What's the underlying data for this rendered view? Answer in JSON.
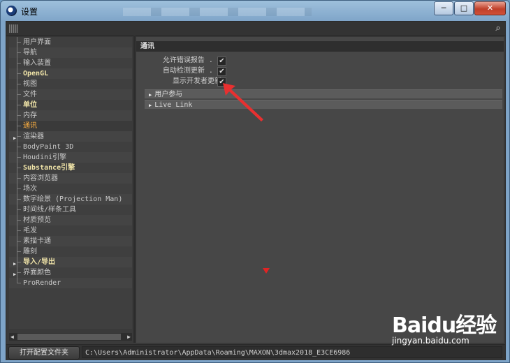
{
  "window": {
    "title": "设置",
    "controls": [
      "─",
      "□",
      "✕"
    ]
  },
  "tree": {
    "items": [
      {
        "label": "用户界面",
        "style": "",
        "expander": false
      },
      {
        "label": "导航",
        "style": "",
        "expander": false
      },
      {
        "label": "输入装置",
        "style": "",
        "expander": false
      },
      {
        "label": "OpenGL",
        "style": "bold",
        "expander": false
      },
      {
        "label": "视图",
        "style": "",
        "expander": false
      },
      {
        "label": "文件",
        "style": "",
        "expander": false
      },
      {
        "label": "单位",
        "style": "bold",
        "expander": false
      },
      {
        "label": "内存",
        "style": "",
        "expander": false
      },
      {
        "label": "通讯",
        "style": "sel",
        "expander": false
      },
      {
        "label": "渲染器",
        "style": "",
        "expander": true
      },
      {
        "label": "BodyPaint 3D",
        "style": "",
        "expander": false
      },
      {
        "label": "Houdini引擎",
        "style": "",
        "expander": false
      },
      {
        "label": "Substance引擎",
        "style": "bold",
        "expander": false
      },
      {
        "label": "内容浏览器",
        "style": "",
        "expander": false
      },
      {
        "label": "场次",
        "style": "",
        "expander": false
      },
      {
        "label": "数字绘景 (Projection Man)",
        "style": "",
        "expander": false
      },
      {
        "label": "时间线/样条工具",
        "style": "",
        "expander": false
      },
      {
        "label": "材质预览",
        "style": "",
        "expander": false
      },
      {
        "label": "毛发",
        "style": "",
        "expander": false
      },
      {
        "label": "素描卡通",
        "style": "",
        "expander": false
      },
      {
        "label": "雕刻",
        "style": "",
        "expander": false
      },
      {
        "label": "导入/导出",
        "style": "bold",
        "expander": true
      },
      {
        "label": "界面颜色",
        "style": "",
        "expander": true
      },
      {
        "label": "ProRender",
        "style": "",
        "expander": false
      }
    ]
  },
  "panel": {
    "title": "通讯",
    "options": [
      {
        "label": "允许错误报告 . .",
        "checked": true
      },
      {
        "label": "自动检测更新 . .",
        "checked": true
      },
      {
        "label": "显示开发者更新",
        "checked": true
      }
    ],
    "groups": [
      "用户参与",
      "Live Link"
    ]
  },
  "bottom": {
    "open_button": "打开配置文件夹",
    "path": "C:\\Users\\Administrator\\AppData\\Roaming\\MAXON\\3dmax2018_E3CE6986"
  },
  "watermark": {
    "brand": "Baidu经验",
    "url": "jingyan.baidu.com"
  },
  "colors": {
    "selected": "#ffb040",
    "highlight": "#f0e4a8",
    "annotation": "#e02424"
  }
}
